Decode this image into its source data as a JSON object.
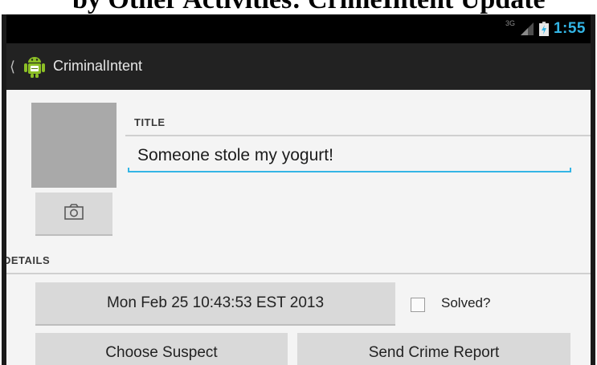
{
  "caption": {
    "text": "by Other Activities: CrimeIntent Update"
  },
  "status_bar": {
    "network_type": "3G",
    "time": "1:55",
    "clock_color": "#33b5e5"
  },
  "action_bar": {
    "up_icon": "chevron-left-icon",
    "app_icon": "android-app-icon",
    "title": "CriminalIntent"
  },
  "crime": {
    "title_label": "TITLE",
    "title_value": "Someone stole my yogurt!",
    "camera_icon": "camera-icon",
    "details_label": "DETAILS",
    "date_button": "Mon Feb 25 10:43:53 EST 2013",
    "solved_label": "Solved?",
    "solved_checked": false,
    "choose_suspect_button": "Choose Suspect",
    "send_report_button": "Send Crime Report",
    "accent_color": "#33b5e5"
  }
}
